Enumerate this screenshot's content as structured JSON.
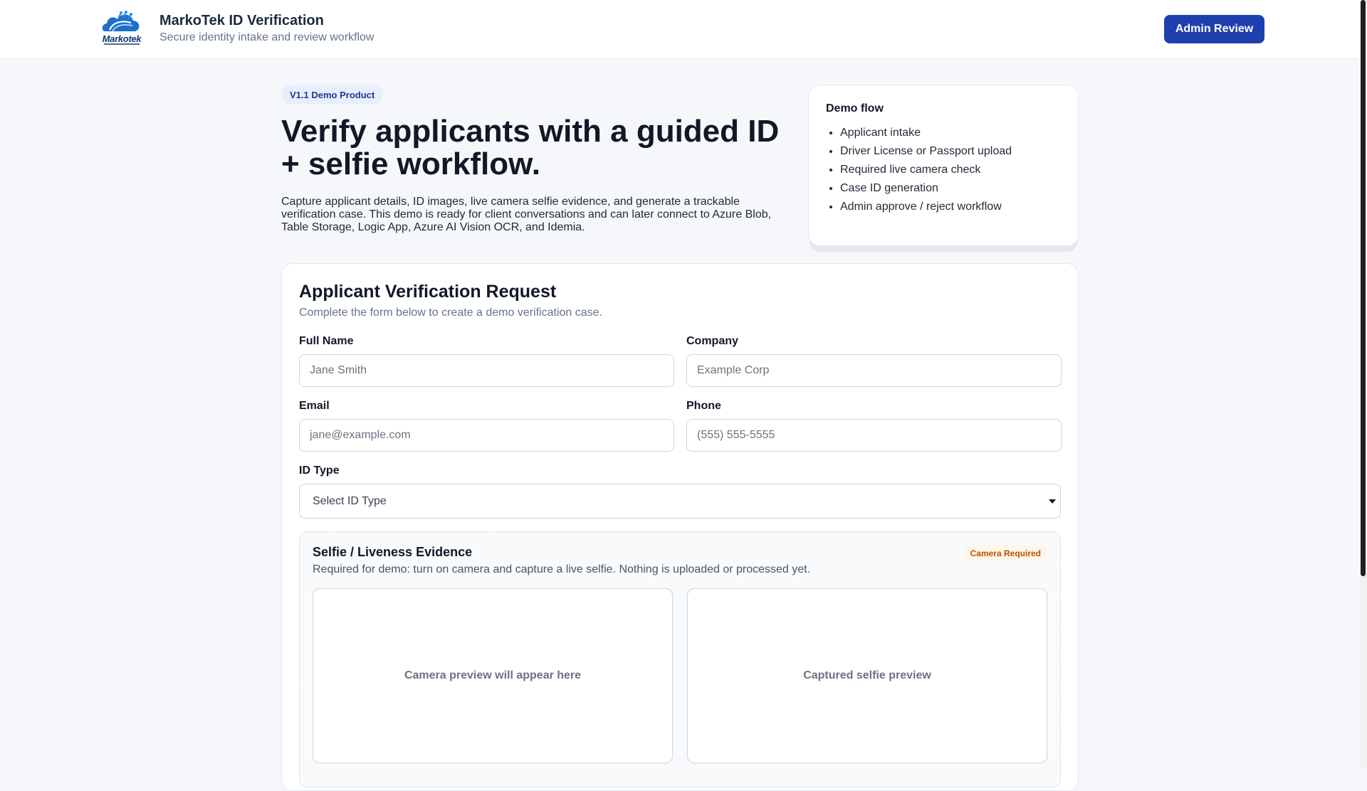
{
  "header": {
    "title": "MarkoTek ID Verification",
    "subtitle": "Secure identity intake and review workflow",
    "logo_text": "Markotek",
    "admin_button": "Admin Review"
  },
  "hero": {
    "badge": "V1.1 Demo Product",
    "title": "Verify applicants with a guided ID + selfie workflow.",
    "description": "Capture applicant details, ID images, live camera selfie evidence, and generate a trackable verification case. This demo is ready for client conversations and can later connect to Azure Blob, Table Storage, Logic App, Azure AI Vision OCR, and Idemia."
  },
  "demo_flow": {
    "title": "Demo flow",
    "items": [
      "Applicant intake",
      "Driver License or Passport upload",
      "Required live camera check",
      "Case ID generation",
      "Admin approve / reject workflow"
    ]
  },
  "form": {
    "title": "Applicant Verification Request",
    "subtitle": "Complete the form below to create a demo verification case.",
    "full_name": {
      "label": "Full Name",
      "placeholder": "Jane Smith",
      "value": ""
    },
    "company": {
      "label": "Company",
      "placeholder": "Example Corp",
      "value": ""
    },
    "email": {
      "label": "Email",
      "placeholder": "jane@example.com",
      "value": ""
    },
    "phone": {
      "label": "Phone",
      "placeholder": "(555) 555-5555",
      "value": ""
    },
    "id_type": {
      "label": "ID Type",
      "selected": "Select ID Type"
    }
  },
  "selfie": {
    "title": "Selfie / Liveness Evidence",
    "description": "Required for demo: turn on camera and capture a live selfie. Nothing is uploaded or processed yet.",
    "badge": "Camera Required",
    "camera_preview": "Camera preview will appear here",
    "captured_preview": "Captured selfie preview"
  },
  "colors": {
    "primary": "#1e40af",
    "badge_bg": "#e8eefc",
    "warning_text": "#b45309",
    "warning_bg": "#fff4e6"
  }
}
